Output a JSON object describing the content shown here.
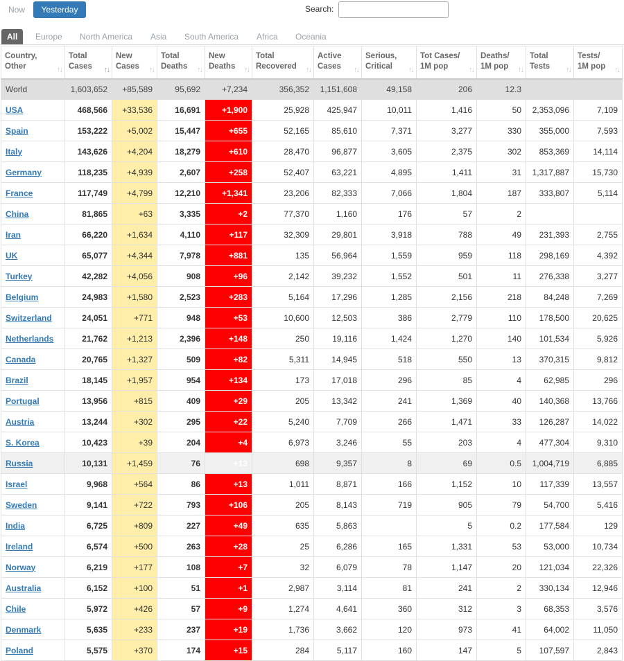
{
  "toggle": {
    "now": "Now",
    "yesterday": "Yesterday"
  },
  "search": {
    "label": "Search:",
    "value": ""
  },
  "regions": [
    "All",
    "Europe",
    "North America",
    "Asia",
    "South America",
    "Africa",
    "Oceania"
  ],
  "columns": [
    [
      "Country,",
      "Other"
    ],
    [
      "Total",
      "Cases"
    ],
    [
      "New",
      "Cases"
    ],
    [
      "Total",
      "Deaths"
    ],
    [
      "New",
      "Deaths"
    ],
    [
      "Total",
      "Recovered"
    ],
    [
      "Active",
      "Cases"
    ],
    [
      "Serious,",
      "Critical"
    ],
    [
      "Tot Cases/",
      "1M pop"
    ],
    [
      "Deaths/",
      "1M pop"
    ],
    [
      "Total",
      "Tests"
    ],
    [
      "Tests/",
      "1M pop"
    ]
  ],
  "world": [
    "World",
    "1,603,652",
    "+85,589",
    "95,692",
    "+7,234",
    "356,352",
    "1,151,608",
    "49,158",
    "206",
    "12.3",
    "",
    ""
  ],
  "rows": [
    [
      "USA",
      "468,566",
      "+33,536",
      "16,691",
      "+1,900",
      "25,928",
      "425,947",
      "10,011",
      "1,416",
      "50",
      "2,353,096",
      "7,109"
    ],
    [
      "Spain",
      "153,222",
      "+5,002",
      "15,447",
      "+655",
      "52,165",
      "85,610",
      "7,371",
      "3,277",
      "330",
      "355,000",
      "7,593"
    ],
    [
      "Italy",
      "143,626",
      "+4,204",
      "18,279",
      "+610",
      "28,470",
      "96,877",
      "3,605",
      "2,375",
      "302",
      "853,369",
      "14,114"
    ],
    [
      "Germany",
      "118,235",
      "+4,939",
      "2,607",
      "+258",
      "52,407",
      "63,221",
      "4,895",
      "1,411",
      "31",
      "1,317,887",
      "15,730"
    ],
    [
      "France",
      "117,749",
      "+4,799",
      "12,210",
      "+1,341",
      "23,206",
      "82,333",
      "7,066",
      "1,804",
      "187",
      "333,807",
      "5,114"
    ],
    [
      "China",
      "81,865",
      "+63",
      "3,335",
      "+2",
      "77,370",
      "1,160",
      "176",
      "57",
      "2",
      "",
      ""
    ],
    [
      "Iran",
      "66,220",
      "+1,634",
      "4,110",
      "+117",
      "32,309",
      "29,801",
      "3,918",
      "788",
      "49",
      "231,393",
      "2,755"
    ],
    [
      "UK",
      "65,077",
      "+4,344",
      "7,978",
      "+881",
      "135",
      "56,964",
      "1,559",
      "959",
      "118",
      "298,169",
      "4,392"
    ],
    [
      "Turkey",
      "42,282",
      "+4,056",
      "908",
      "+96",
      "2,142",
      "39,232",
      "1,552",
      "501",
      "11",
      "276,338",
      "3,277"
    ],
    [
      "Belgium",
      "24,983",
      "+1,580",
      "2,523",
      "+283",
      "5,164",
      "17,296",
      "1,285",
      "2,156",
      "218",
      "84,248",
      "7,269"
    ],
    [
      "Switzerland",
      "24,051",
      "+771",
      "948",
      "+53",
      "10,600",
      "12,503",
      "386",
      "2,779",
      "110",
      "178,500",
      "20,625"
    ],
    [
      "Netherlands",
      "21,762",
      "+1,213",
      "2,396",
      "+148",
      "250",
      "19,116",
      "1,424",
      "1,270",
      "140",
      "101,534",
      "5,926"
    ],
    [
      "Canada",
      "20,765",
      "+1,327",
      "509",
      "+82",
      "5,311",
      "14,945",
      "518",
      "550",
      "13",
      "370,315",
      "9,812"
    ],
    [
      "Brazil",
      "18,145",
      "+1,957",
      "954",
      "+134",
      "173",
      "17,018",
      "296",
      "85",
      "4",
      "62,985",
      "296"
    ],
    [
      "Portugal",
      "13,956",
      "+815",
      "409",
      "+29",
      "205",
      "13,342",
      "241",
      "1,369",
      "40",
      "140,368",
      "13,766"
    ],
    [
      "Austria",
      "13,244",
      "+302",
      "295",
      "+22",
      "5,240",
      "7,709",
      "266",
      "1,471",
      "33",
      "126,287",
      "14,022"
    ],
    [
      "S. Korea",
      "10,423",
      "+39",
      "204",
      "+4",
      "6,973",
      "3,246",
      "55",
      "203",
      "4",
      "477,304",
      "9,310"
    ],
    [
      "Russia",
      "10,131",
      "+1,459",
      "76",
      "+13",
      "698",
      "9,357",
      "8",
      "69",
      "0.5",
      "1,004,719",
      "6,885"
    ],
    [
      "Israel",
      "9,968",
      "+564",
      "86",
      "+13",
      "1,011",
      "8,871",
      "166",
      "1,152",
      "10",
      "117,339",
      "13,557"
    ],
    [
      "Sweden",
      "9,141",
      "+722",
      "793",
      "+106",
      "205",
      "8,143",
      "719",
      "905",
      "79",
      "54,700",
      "5,416"
    ],
    [
      "India",
      "6,725",
      "+809",
      "227",
      "+49",
      "635",
      "5,863",
      "",
      "5",
      "0.2",
      "177,584",
      "129"
    ],
    [
      "Ireland",
      "6,574",
      "+500",
      "263",
      "+28",
      "25",
      "6,286",
      "165",
      "1,331",
      "53",
      "53,000",
      "10,734"
    ],
    [
      "Norway",
      "6,219",
      "+177",
      "108",
      "+7",
      "32",
      "6,079",
      "78",
      "1,147",
      "20",
      "121,034",
      "22,326"
    ],
    [
      "Australia",
      "6,152",
      "+100",
      "51",
      "+1",
      "2,987",
      "3,114",
      "81",
      "241",
      "2",
      "330,134",
      "12,946"
    ],
    [
      "Chile",
      "5,972",
      "+426",
      "57",
      "+9",
      "1,274",
      "4,641",
      "360",
      "312",
      "3",
      "68,353",
      "3,576"
    ],
    [
      "Denmark",
      "5,635",
      "+233",
      "237",
      "+19",
      "1,736",
      "3,662",
      "120",
      "973",
      "41",
      "64,002",
      "11,050"
    ],
    [
      "Poland",
      "5,575",
      "+370",
      "174",
      "+15",
      "284",
      "5,117",
      "160",
      "147",
      "5",
      "107,597",
      "2,843"
    ]
  ],
  "highlight_row": "Russia",
  "colors": {
    "accent": "#337ab7",
    "new_cases_bg": "#ffeeaa",
    "new_deaths_bg": "#ff0000",
    "world_bg": "#dfdfdf"
  },
  "icons": {
    "sort": "sort-arrows-icon"
  }
}
